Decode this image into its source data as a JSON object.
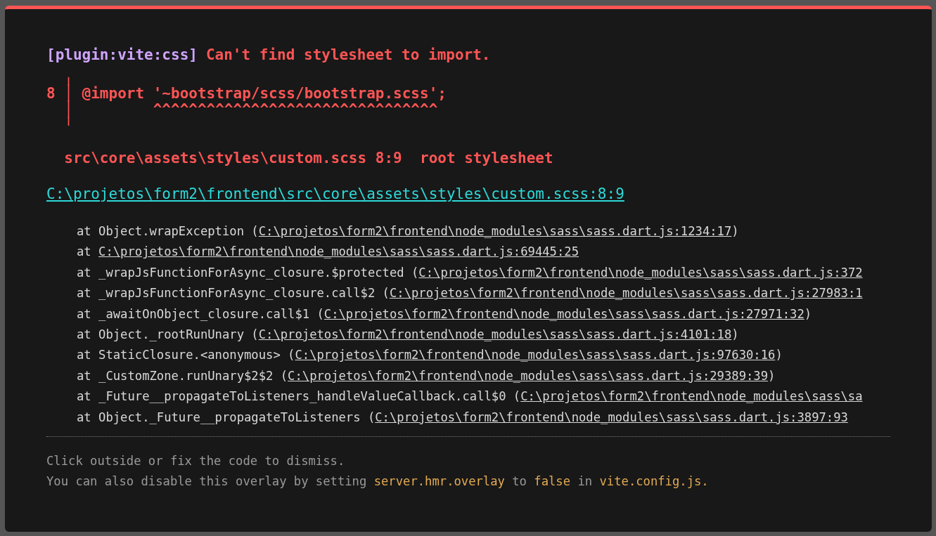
{
  "error": {
    "plugin": "[plugin:vite:css]",
    "message": "Can't find stylesheet to import.",
    "frame": [
      "  ╷",
      "8 │ @import '~bootstrap/scss/bootstrap.scss';",
      "  │         ^^^^^^^^^^^^^^^^^^^^^^^^^^^^^^^^",
      "  ╵"
    ],
    "location": "  src\\core\\assets\\styles\\custom.scss 8:9  root stylesheet",
    "file_link": "C:\\projetos\\form2\\frontend\\src\\core\\assets\\styles\\custom.scss:8:9",
    "stack": [
      {
        "prefix": "at Object.wrapException (",
        "link": "C:\\projetos\\form2\\frontend\\node_modules\\sass\\sass.dart.js:1234:17",
        "suffix": ")"
      },
      {
        "prefix": "at ",
        "link": "C:\\projetos\\form2\\frontend\\node_modules\\sass\\sass.dart.js:69445:25"
      },
      {
        "prefix": "at _wrapJsFunctionForAsync_closure.$protected (",
        "link": "C:\\projetos\\form2\\frontend\\node_modules\\sass\\sass.dart.js:372"
      },
      {
        "prefix": "at _wrapJsFunctionForAsync_closure.call$2 (",
        "link": "C:\\projetos\\form2\\frontend\\node_modules\\sass\\sass.dart.js:27983:1"
      },
      {
        "prefix": "at _awaitOnObject_closure.call$1 (",
        "link": "C:\\projetos\\form2\\frontend\\node_modules\\sass\\sass.dart.js:27971:32",
        "suffix": ")"
      },
      {
        "prefix": "at Object._rootRunUnary (",
        "link": "C:\\projetos\\form2\\frontend\\node_modules\\sass\\sass.dart.js:4101:18",
        "suffix": ")"
      },
      {
        "prefix": "at StaticClosure.<anonymous> (",
        "link": "C:\\projetos\\form2\\frontend\\node_modules\\sass\\sass.dart.js:97630:16",
        "suffix": ")"
      },
      {
        "prefix": "at _CustomZone.runUnary$2$2 (",
        "link": "C:\\projetos\\form2\\frontend\\node_modules\\sass\\sass.dart.js:29389:39",
        "suffix": ")"
      },
      {
        "prefix": "at _Future__propagateToListeners_handleValueCallback.call$0 (",
        "link": "C:\\projetos\\form2\\frontend\\node_modules\\sass\\sa"
      },
      {
        "prefix": "at Object._Future__propagateToListeners (",
        "link": "C:\\projetos\\form2\\frontend\\node_modules\\sass\\sass.dart.js:3897:93"
      }
    ]
  },
  "tip": [
    [
      {
        "kind": "text",
        "text": "Click outside or fix the code to dismiss."
      }
    ],
    [
      {
        "kind": "text",
        "text": "You can also disable this overlay by setting "
      },
      {
        "kind": "code",
        "text": "server.hmr.overlay"
      },
      {
        "kind": "text",
        "text": " to "
      },
      {
        "kind": "code",
        "text": "false"
      },
      {
        "kind": "text",
        "text": " in "
      },
      {
        "kind": "code",
        "text": "vite.config.js."
      }
    ]
  ]
}
